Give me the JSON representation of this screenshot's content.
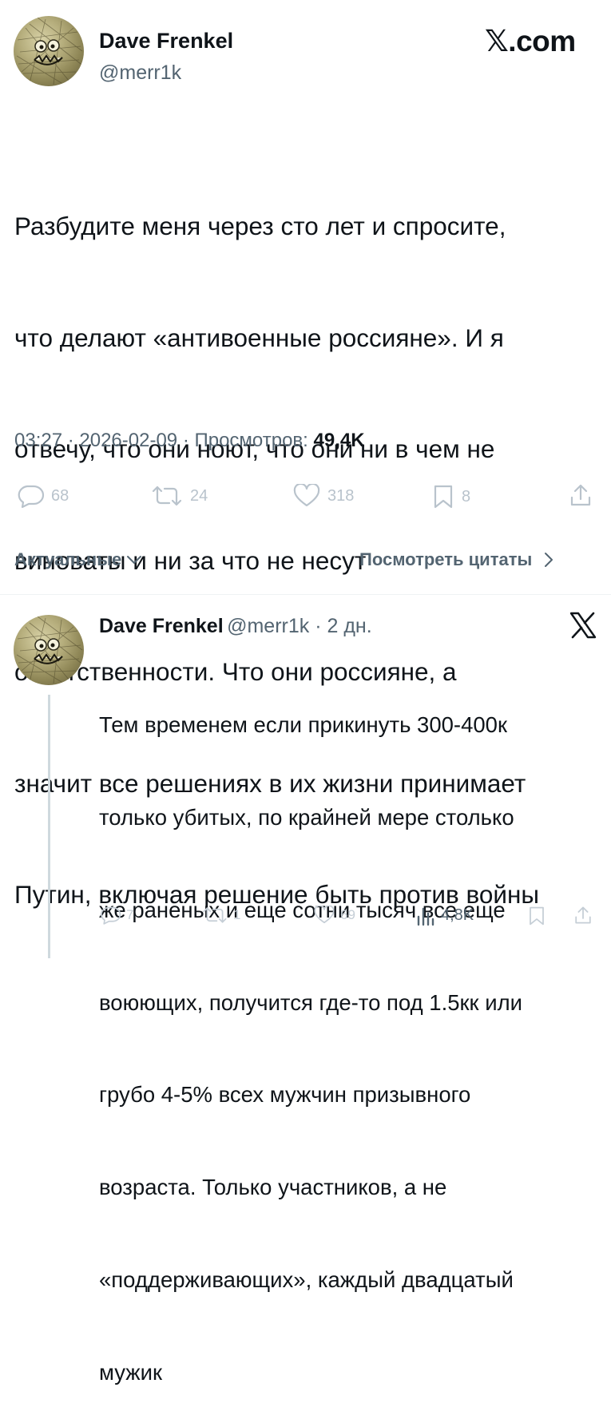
{
  "tweet": {
    "author_name": "Dave Frenkel",
    "author_handle": "@merr1k",
    "site": "𝕏.com",
    "text_lines": [
      "Разбудите меня через сто лет и спросите,",
      "что делают «антивоенные россияне». И я",
      "отвечу, что они ноют, что они ни в чем не",
      "виноваты и ни за что не несут",
      "ответственности. Что они россияне, а",
      "значит все решениях в их жизни принимает",
      "Путин, включая решение быть против войны"
    ],
    "timestamp": "03:27 · 2026-02-09 · Просмотров:",
    "views": "49,4K",
    "actions": {
      "replies": "68",
      "reposts": "24",
      "likes": "318",
      "bookmarks": "8"
    }
  },
  "sort": {
    "label": "Актуальные",
    "quotes_label": "Посмотреть цитаты"
  },
  "reply": {
    "author_name": "Dave Frenkel",
    "meta": "@merr1k · 2 дн.",
    "text_lines": [
      "Тем временем если прикинуть 300-400к",
      "только убитых, по крайней мере столько",
      "же раненых и еще сотни тысяч все еще",
      "воюющих, получится где-то под 1.5кк или",
      "грубо 4-5% всех мужчин призывного",
      "возраста. Только участников, а не",
      "«поддерживающих», каждый двадцатый",
      "мужик"
    ],
    "actions": {
      "replies": "7",
      "reposts": "1",
      "likes": "69",
      "views": "4,8K"
    }
  },
  "icons": {
    "avatar": "avatar-monster-drawing",
    "reply": "speech-bubble-icon",
    "repost": "repost-icon",
    "like": "heart-icon",
    "bookmark": "bookmark-icon",
    "share": "share-icon",
    "views": "bar-chart-icon",
    "x_logo": "x-logo-icon",
    "chevron_down": "chevron-down-icon",
    "chevron_right": "chevron-right-icon"
  }
}
